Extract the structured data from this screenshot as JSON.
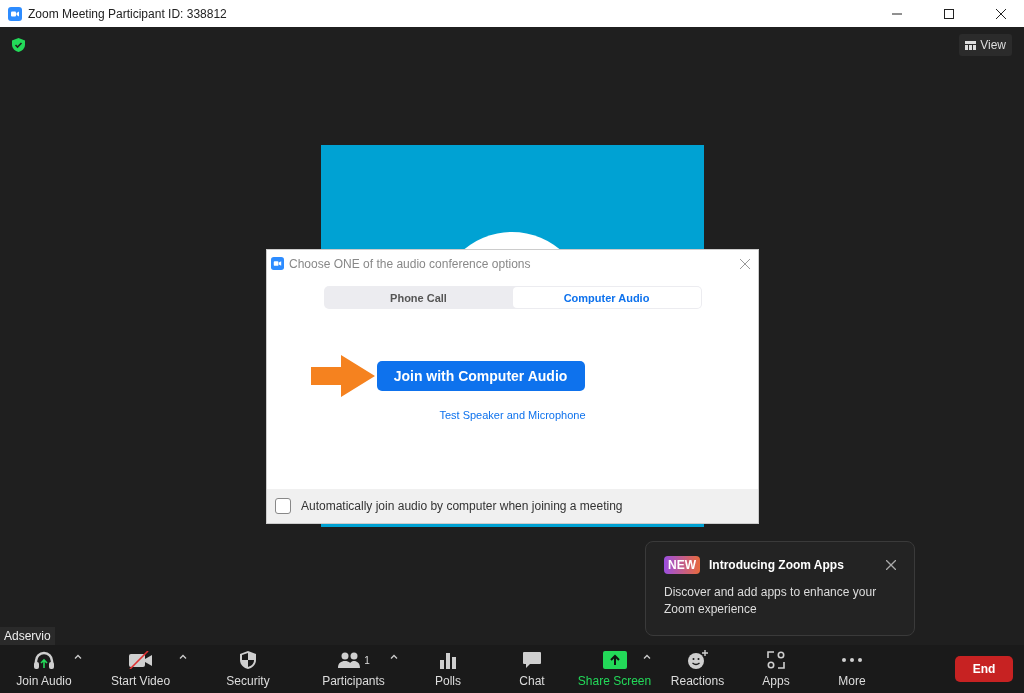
{
  "window": {
    "title": "Zoom Meeting Participant ID: 338812"
  },
  "view_button": {
    "label": "View"
  },
  "dialog": {
    "title": "Choose ONE of the audio conference options",
    "tabs": [
      {
        "label": "Phone Call",
        "selected": false
      },
      {
        "label": "Computer Audio",
        "selected": true
      }
    ],
    "primary_button": "Join with Computer Audio",
    "link": "Test Speaker and Microphone",
    "auto_join": {
      "label": "Automatically join audio by computer when joining a meeting",
      "checked": false
    }
  },
  "popup": {
    "badge": "NEW",
    "title": "Introducing Zoom Apps",
    "body": "Discover and add apps to enhance your Zoom experience"
  },
  "name_tag": "Adservio",
  "toolbar": [
    {
      "kind": "audio",
      "label": "Join Audio",
      "caret": true
    },
    {
      "kind": "video",
      "label": "Start Video",
      "caret": true
    },
    {
      "kind": "security",
      "label": "Security",
      "caret": false
    },
    {
      "kind": "participants",
      "label": "Participants",
      "caret": true,
      "count": "1"
    },
    {
      "kind": "polls",
      "label": "Polls",
      "caret": false
    },
    {
      "kind": "chat",
      "label": "Chat",
      "caret": false
    },
    {
      "kind": "share",
      "label": "Share Screen",
      "caret": true
    },
    {
      "kind": "reactions",
      "label": "Reactions",
      "caret": false
    },
    {
      "kind": "apps",
      "label": "Apps",
      "caret": false
    },
    {
      "kind": "more",
      "label": "More",
      "caret": false
    }
  ],
  "end_button": "End"
}
